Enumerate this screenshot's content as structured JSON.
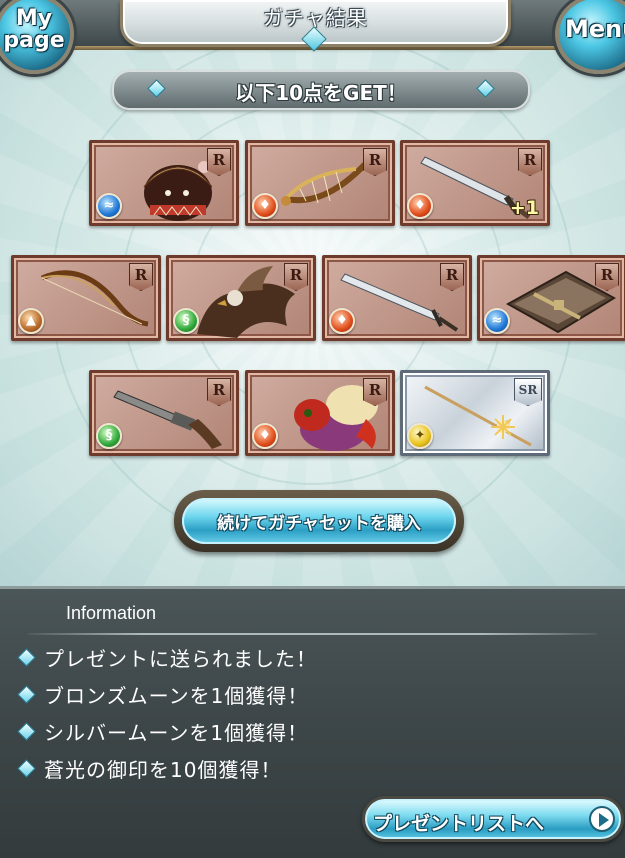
{
  "header": {
    "title": "ガチャ結果",
    "mypage_line1": "My",
    "mypage_line2": "page",
    "menu_label": "Menu"
  },
  "banner": {
    "text": "以下10点をGET！"
  },
  "items": [
    {
      "rarity": "R",
      "element": "water",
      "element_icon": "water-icon",
      "art": "hooded-character",
      "plus": ""
    },
    {
      "rarity": "R",
      "element": "fire",
      "element_icon": "fire-icon",
      "art": "harp",
      "plus": ""
    },
    {
      "rarity": "R",
      "element": "fire",
      "element_icon": "fire-icon",
      "art": "greatsword",
      "plus": "+1"
    },
    {
      "rarity": "R",
      "element": "earth",
      "element_icon": "earth-icon",
      "art": "bow",
      "plus": ""
    },
    {
      "rarity": "R",
      "element": "wind",
      "element_icon": "wind-icon",
      "art": "griffin",
      "plus": ""
    },
    {
      "rarity": "R",
      "element": "fire",
      "element_icon": "fire-icon",
      "art": "longsword",
      "plus": ""
    },
    {
      "rarity": "R",
      "element": "water",
      "element_icon": "water-icon",
      "art": "tome",
      "plus": ""
    },
    {
      "rarity": "R",
      "element": "wind",
      "element_icon": "wind-icon",
      "art": "gun",
      "plus": ""
    },
    {
      "rarity": "R",
      "element": "fire",
      "element_icon": "fire-icon",
      "art": "bird-creature",
      "plus": ""
    },
    {
      "rarity": "SR",
      "element": "light",
      "element_icon": "light-icon",
      "art": "spear",
      "plus": ""
    }
  ],
  "continue_button": {
    "label": "続けてガチャセットを購入"
  },
  "info": {
    "heading": "Information",
    "lines": [
      "プレゼントに送られました！",
      "ブロンズムーンを1個獲得！",
      "シルバームーンを1個獲得！",
      "蒼光の御印を10個獲得！"
    ],
    "present_button": "プレゼントリストへ"
  },
  "colors": {
    "card_r": "#c09080",
    "card_border_r": "#6e3a2c",
    "button_blue": "#2b9fc4",
    "info_bg": "#3d4648"
  }
}
